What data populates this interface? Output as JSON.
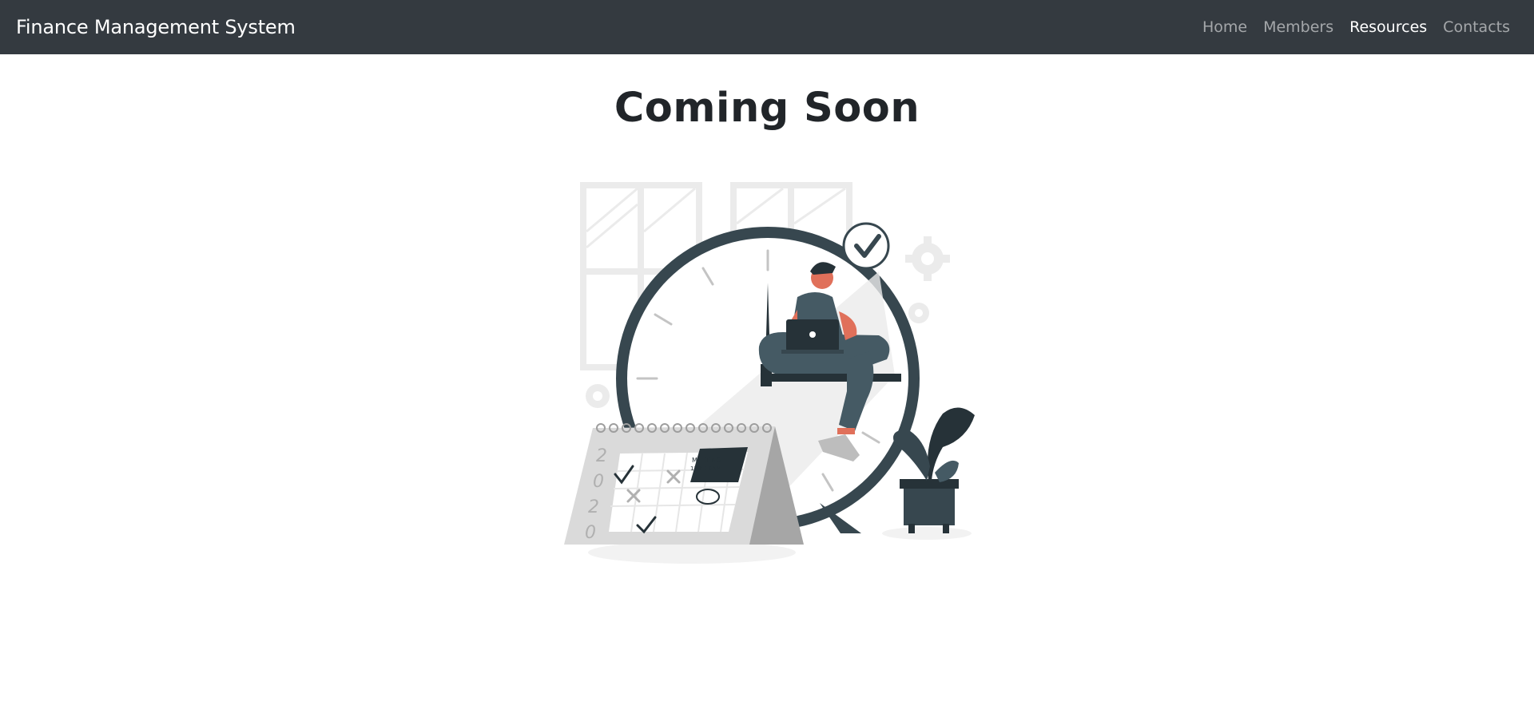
{
  "navbar": {
    "brand": "Finance Management System",
    "links": [
      {
        "label": "Home",
        "active": false
      },
      {
        "label": "Members",
        "active": false
      },
      {
        "label": "Resources",
        "active": true
      },
      {
        "label": "Contacts",
        "active": false
      }
    ]
  },
  "main": {
    "title": "Coming Soon",
    "illustration": {
      "calendar_year_digits": [
        "2",
        "0",
        "2",
        "0"
      ],
      "sticky_note_text": [
        "MEETING",
        "11th 10AM"
      ]
    }
  },
  "colors": {
    "navbar_bg": "#343a40",
    "dark_slate": "#37474f",
    "accent_skin": "#e0705a",
    "light_gray": "#ebebeb"
  }
}
